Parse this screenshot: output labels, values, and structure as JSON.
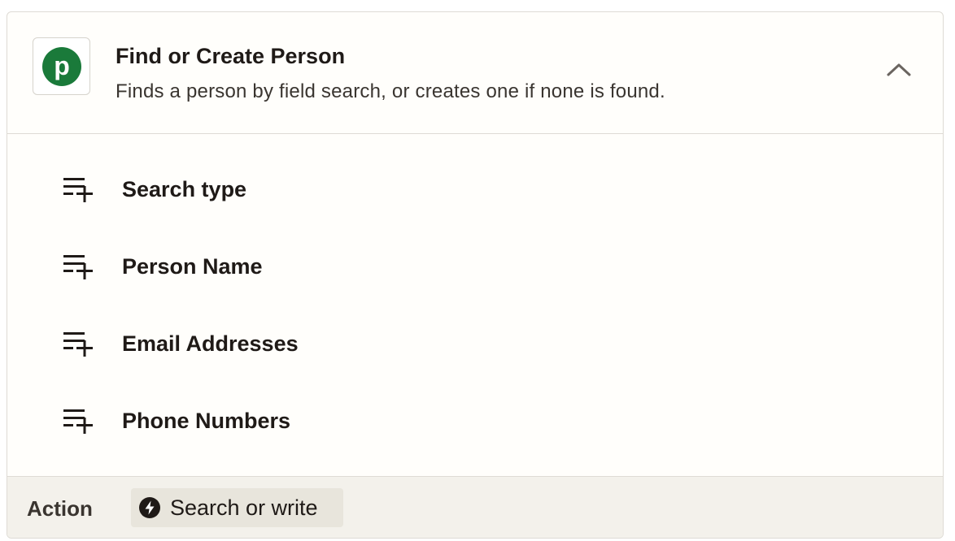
{
  "header": {
    "title": "Find or Create Person",
    "description": "Finds a person by field search, or creates one if none is found.",
    "app_logo_letter": "p",
    "app_color": "#1a7a3a"
  },
  "fields": [
    {
      "label": "Search type",
      "icon": "add-field-icon"
    },
    {
      "label": "Person Name",
      "icon": "add-field-icon"
    },
    {
      "label": "Email Addresses",
      "icon": "add-field-icon"
    },
    {
      "label": "Phone Numbers",
      "icon": "add-field-icon"
    }
  ],
  "footer": {
    "label": "Action",
    "chip_label": "Search or write",
    "chip_icon": "lightning-icon"
  }
}
